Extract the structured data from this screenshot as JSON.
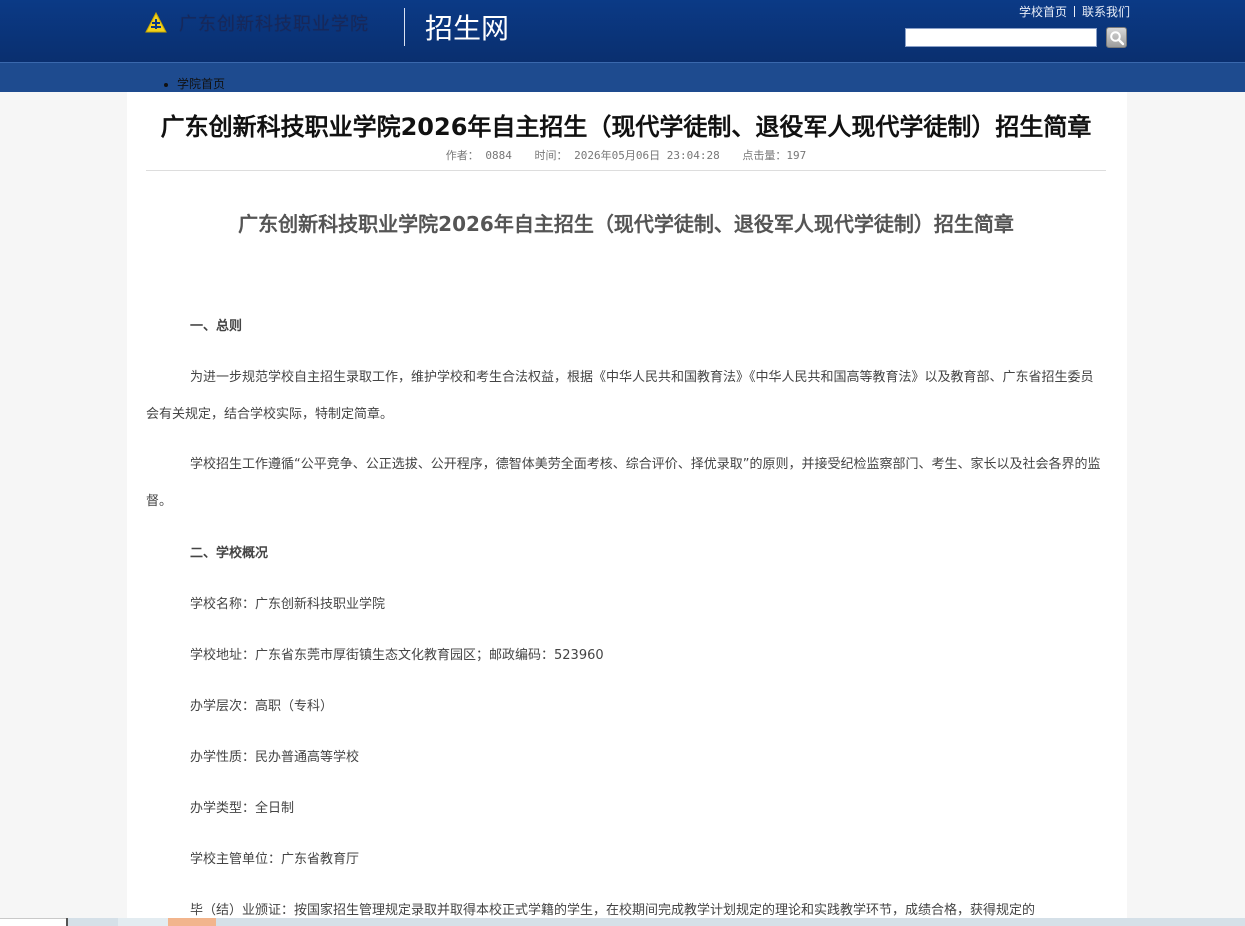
{
  "header": {
    "logo_text": "广东创新科技职业学院",
    "site_name": "招生网",
    "links": [
      "学校首页",
      "联系我们"
    ],
    "search_value": "",
    "search_button_icon": "magnifier-icon"
  },
  "nav": {
    "items": [
      "学院首页"
    ]
  },
  "article": {
    "title": "广东创新科技职业学院2026年自主招生（现代学徒制、退役军人现代学徒制）招生简章",
    "meta": {
      "author": "作者： 0884",
      "time": "时间： 2026年05月06日 23:04:28",
      "views": "点击量：197"
    },
    "body_title": "广东创新科技职业学院2026年自主招生（现代学徒制、退役军人现代学徒制）招生简章",
    "paragraphs": [
      "一、总则",
      "为进一步规范学校自主招生录取工作，维护学校和考生合法权益，根据《中华人民共和国教育法》《中华人民共和国高等教育法》以及教育部、广东省招生委员会有关规定，结合学校实际，特制定简章。",
      "学校招生工作遵循“公平竞争、公正选拔、公开程序，德智体美劳全面考核、综合评价、择优录取”的原则，并接受纪检监察部门、考生、家长以及社会各界的监督。",
      "二、学校概况",
      "学校名称：广东创新科技职业学院",
      "学校地址：广东省东莞市厚街镇生态文化教育园区；邮政编码：523960",
      "办学层次：高职（专科）",
      "办学性质：民办普通高等学校",
      "办学类型：全日制",
      "学校主管单位：广东省教育厅",
      "毕（结）业颁证：按国家招生管理规定录取并取得本校正式学籍的学生，在校期间完成教学计划规定的理论和实践教学环节，成绩合格，获得规定的"
    ]
  },
  "colors": {
    "header_bg": "#0b3a86",
    "nav_bg": "#1e4b8f",
    "page_bg": "#f6f6f6"
  }
}
